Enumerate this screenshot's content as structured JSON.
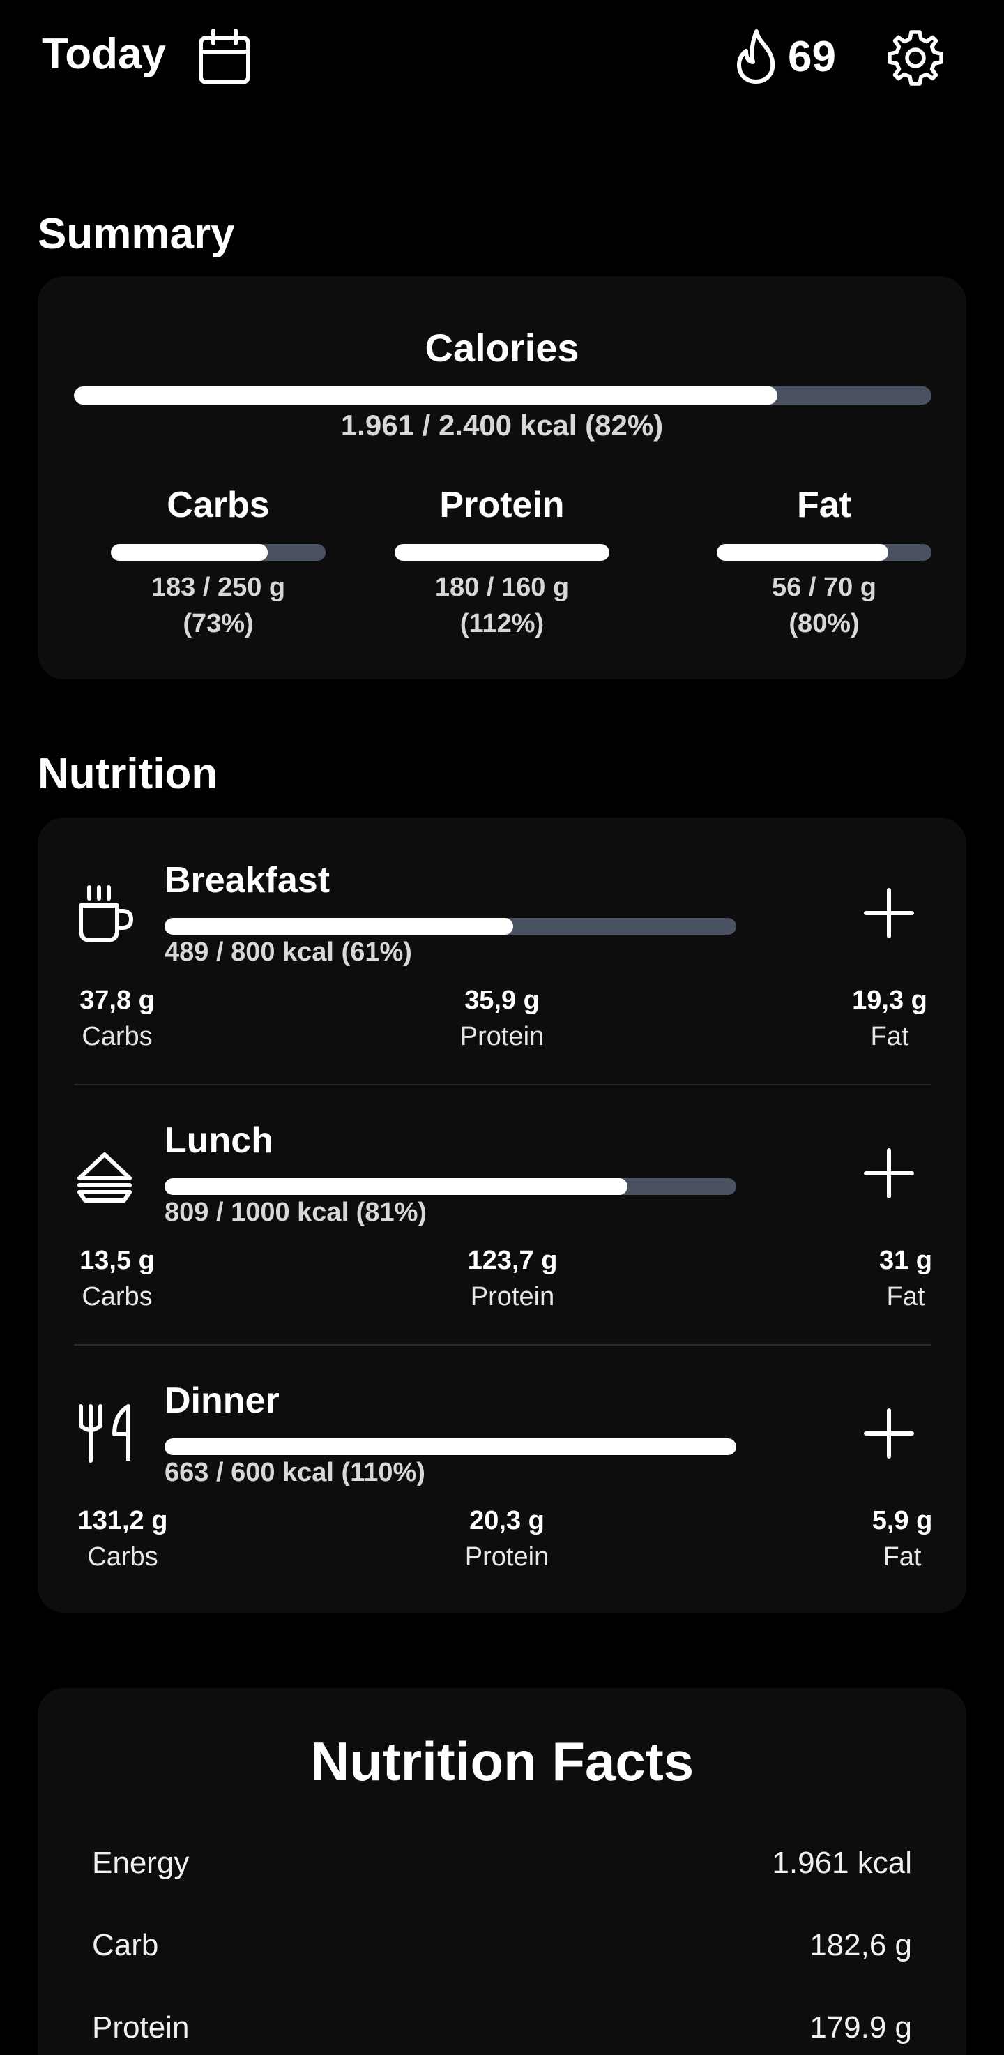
{
  "header": {
    "title": "Today",
    "calendar_icon": "calendar-icon",
    "streak_icon": "flame-icon",
    "streak_count": "69",
    "settings_icon": "gear-icon"
  },
  "summary": {
    "heading": "Summary",
    "calories": {
      "title": "Calories",
      "text": "1.961 / 2.400 kcal (82%)",
      "progress": 0.82
    },
    "macros": [
      {
        "title": "Carbs",
        "amount": "183 / 250 g",
        "percent": "(73%)",
        "progress": 0.73
      },
      {
        "title": "Protein",
        "amount": "180 / 160 g",
        "percent": "(112%)",
        "progress": 1.0
      },
      {
        "title": "Fat",
        "amount": "56 / 70 g",
        "percent": "(80%)",
        "progress": 0.8
      }
    ]
  },
  "nutrition": {
    "heading": "Nutrition",
    "meals": [
      {
        "name": "Breakfast",
        "icon": "coffee-cup-icon",
        "kcal": "489 / 800 kcal (61%)",
        "progress": 0.61,
        "carbs_value": "37,8 g",
        "carbs_label": "Carbs",
        "protein_value": "35,9 g",
        "protein_label": "Protein",
        "fat_value": "19,3 g",
        "fat_label": "Fat"
      },
      {
        "name": "Lunch",
        "icon": "sandwich-icon",
        "kcal": "809 / 1000 kcal (81%)",
        "progress": 0.81,
        "carbs_value": "13,5 g",
        "carbs_label": "Carbs",
        "protein_value": "123,7 g",
        "protein_label": "Protein",
        "fat_value": "31 g",
        "fat_label": "Fat"
      },
      {
        "name": "Dinner",
        "icon": "cutlery-icon",
        "kcal": "663 / 600 kcal (110%)",
        "progress": 1.0,
        "carbs_value": "131,2 g",
        "carbs_label": "Carbs",
        "protein_value": "20,3 g",
        "protein_label": "Protein",
        "fat_value": "5,9 g",
        "fat_label": "Fat"
      }
    ],
    "add_icon": "plus-icon"
  },
  "facts": {
    "title": "Nutrition Facts",
    "rows": [
      {
        "label": "Energy",
        "value": "1.961 kcal"
      },
      {
        "label": "Carb",
        "value": "182,6 g"
      },
      {
        "label": "Protein",
        "value": "179.9 g"
      }
    ]
  },
  "colors": {
    "background": "#000000",
    "card": "#0d0d0d",
    "bar_track": "#4a5160",
    "bar_fill": "#ffffff"
  }
}
